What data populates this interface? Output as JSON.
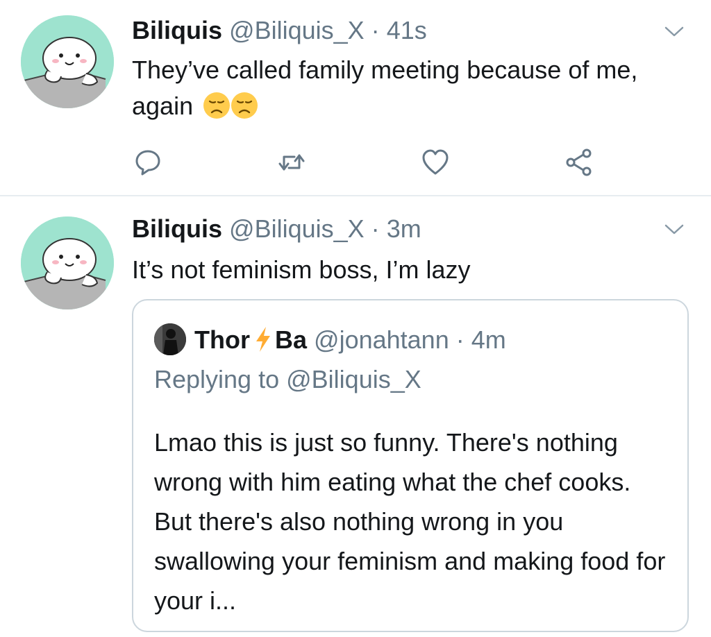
{
  "tweets": [
    {
      "name": "Biliquis",
      "handle": "@Biliquis_X",
      "separator": "·",
      "time": "41s",
      "text": "They’ve called family meeting because of me, again",
      "emojis": [
        "disappointed-face",
        "disappointed-face"
      ]
    },
    {
      "name": "Biliquis",
      "handle": "@Biliquis_X",
      "separator": "·",
      "time": "3m",
      "text": "It’s not feminism boss, I’m lazy",
      "quote": {
        "name_start": "Thor",
        "name_end": "Ba",
        "name_emoji": "high-voltage",
        "handle": "@jonahtann",
        "separator": "·",
        "time": "4m",
        "replying_prefix": "Replying to",
        "replying_to": "@Biliquis_X",
        "text": "Lmao this is just so funny. There's nothing wrong with him eating what the chef cooks. But there's also nothing wrong in you swallowing your feminism and making food for your i..."
      }
    }
  ],
  "icons": {
    "reply": "reply-icon",
    "retweet": "retweet-icon",
    "like": "heart-icon",
    "share": "share-icon",
    "menu": "chevron-down-icon"
  },
  "colors": {
    "text": "#14171a",
    "secondary": "#657786",
    "divider": "#e6ecf0",
    "quote_border": "#ccd6dd",
    "avatar_bg": "#9ee3cf",
    "emoji_yellow": "#ffcc4d"
  }
}
